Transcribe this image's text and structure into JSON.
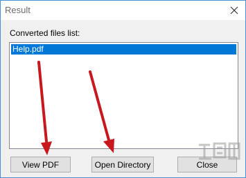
{
  "window": {
    "title": "Result",
    "close_glyph": "✕"
  },
  "content": {
    "list_label": "Converted files list:",
    "files": [
      "Help.pdf"
    ],
    "selected_index": 0
  },
  "buttons": {
    "view_pdf": "View PDF",
    "open_directory": "Open Directory",
    "close": "Close"
  },
  "colors": {
    "selection": "#0078d7",
    "annotation_arrow": "#c8181e",
    "window_border": "#4a8fd6"
  },
  "icons": {
    "close": "close-icon",
    "arrows": "annotation-arrow"
  }
}
